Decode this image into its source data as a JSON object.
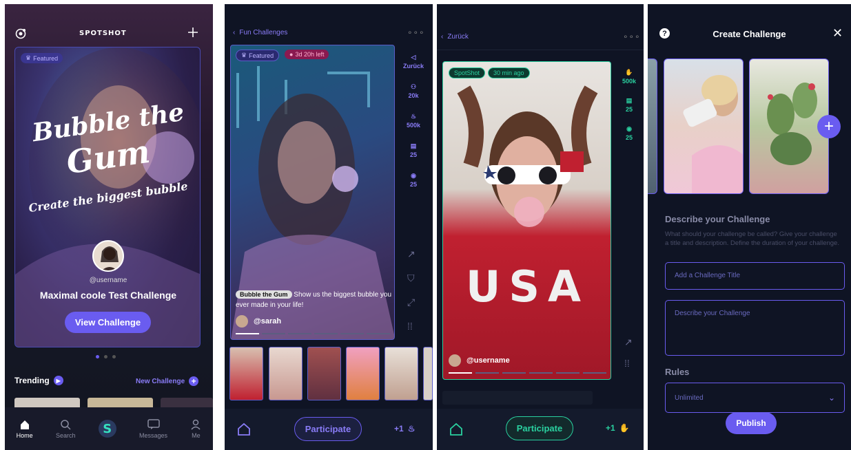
{
  "screen1": {
    "logo": "SPOTSHOT",
    "featured_badge": "Featured",
    "title_line1": "Bubble the",
    "title_line2": "Gum",
    "subtitle": "Create the biggest bubble",
    "username": "@username",
    "challenge_name": "Maximal coole Test Challenge",
    "view_button": "View Challenge",
    "trending_label": "Trending",
    "new_challenge_label": "New Challenge",
    "nav": [
      {
        "label": "Home",
        "icon": "home-icon"
      },
      {
        "label": "Search",
        "icon": "search-icon"
      },
      {
        "label": "",
        "icon": "spotshot-logo-icon"
      },
      {
        "label": "Messages",
        "icon": "messages-icon"
      },
      {
        "label": "Me",
        "icon": "profile-icon"
      }
    ],
    "accent": "#6a5cf0"
  },
  "screen2": {
    "back_label": "Fun Challenges",
    "featured_badge": "Featured",
    "time_badge": "3d 20h left",
    "side_back": "Zurück",
    "participants": "20k",
    "likes": "500k",
    "comments": "25",
    "views": "25",
    "caption_tag": "Bubble the Gum",
    "caption_text": "Show us  the biggest bubble you ever made in your life!",
    "author": "@sarah",
    "participate_button": "Participate",
    "plus_count": "+1"
  },
  "screen3": {
    "back_label": "Zurück",
    "badge_brand": "SpotShot",
    "badge_time": "30 min ago",
    "claps": "500k",
    "comments": "25",
    "views": "25",
    "author": "@username",
    "shirt_text": "USA",
    "participate_button": "Participate",
    "plus_count": "+1",
    "accent": "#2ad1a0"
  },
  "screen4": {
    "title": "Create Challenge",
    "describe_heading": "Describe your Challenge",
    "describe_help": "What should your challenge be called? Give your challenge a title and description. Define the duration of your challenge.",
    "title_placeholder": "Add a Challenge Title",
    "desc_placeholder": "Describe your Challenge",
    "rules_heading": "Rules",
    "rules_value": "Unlimited",
    "publish_button": "Publish"
  }
}
